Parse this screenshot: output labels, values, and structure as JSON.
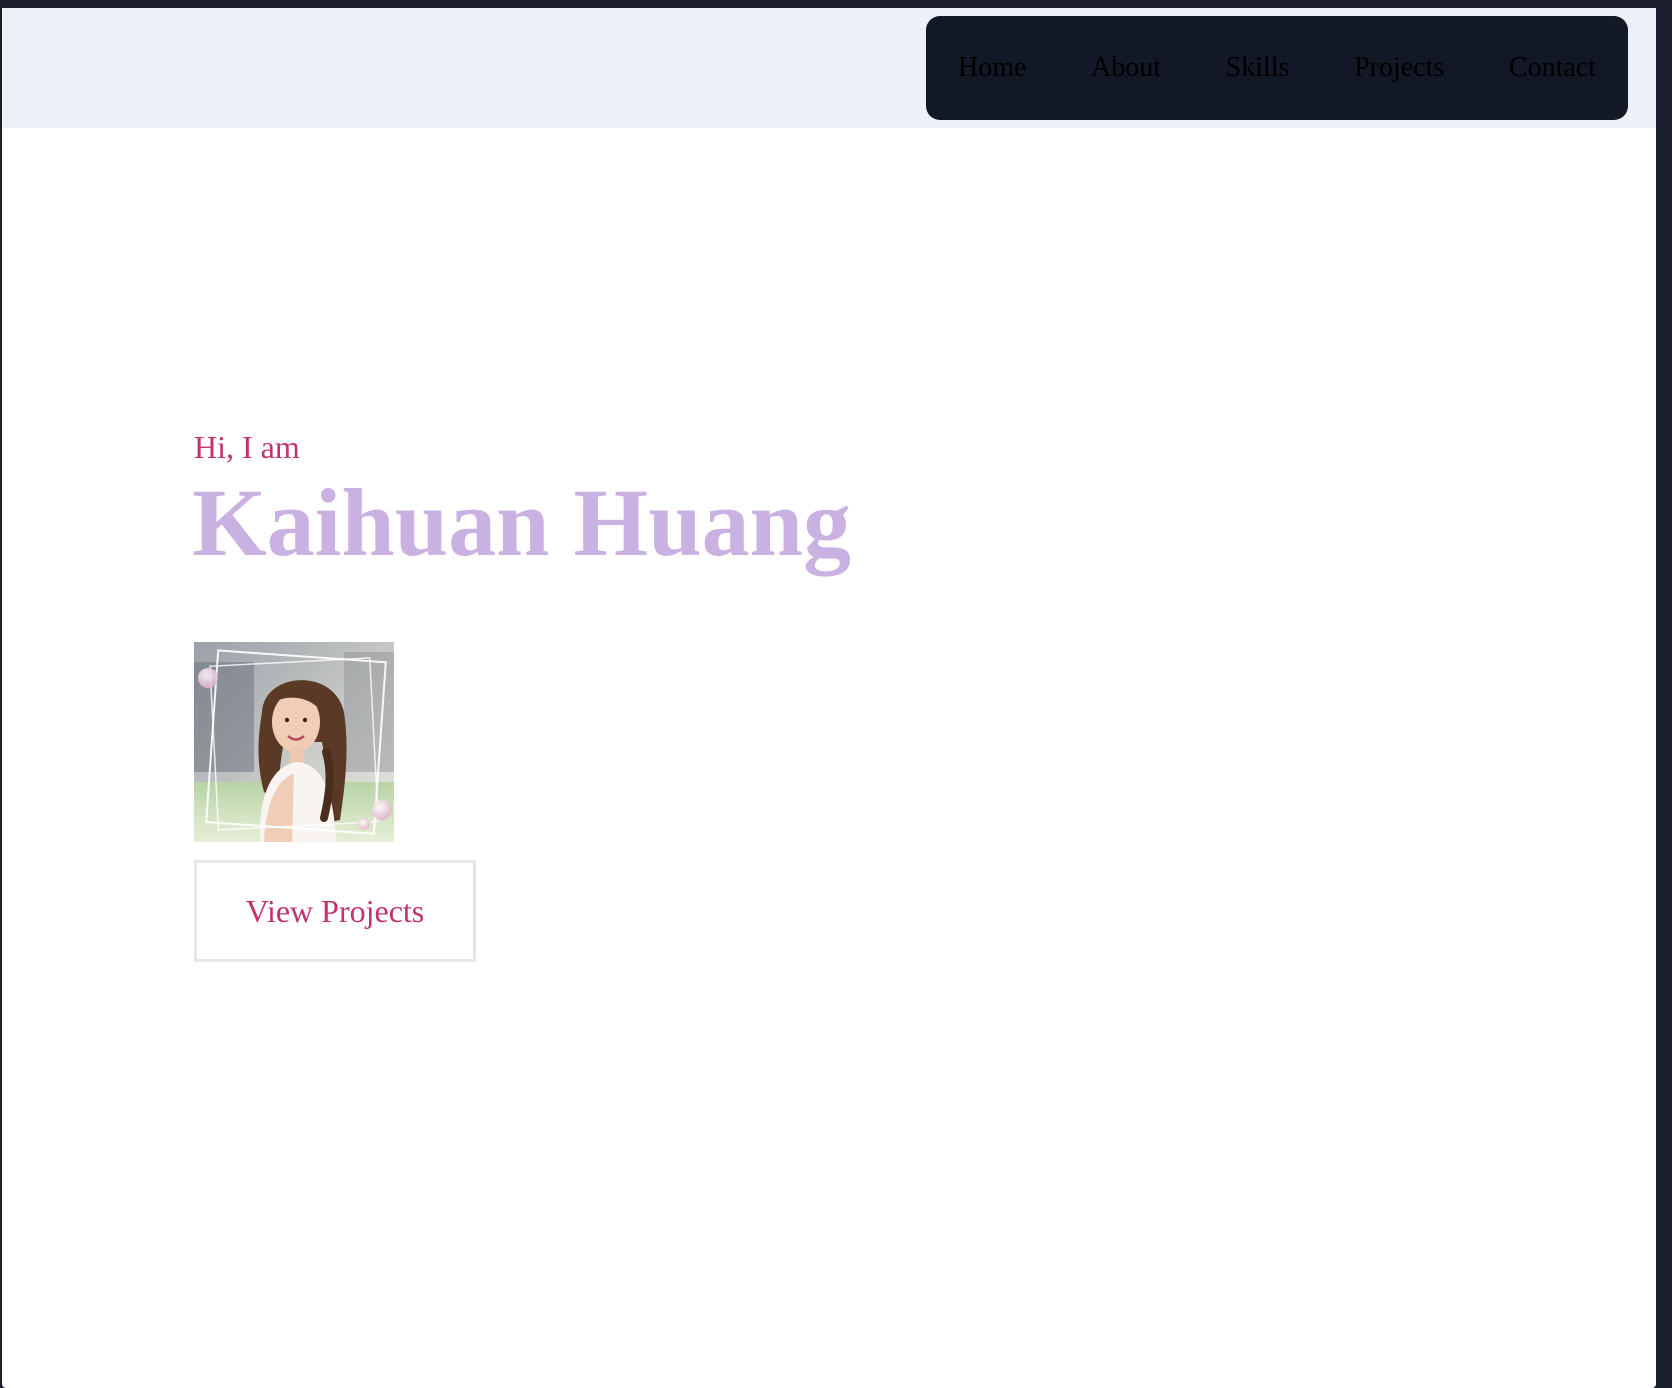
{
  "nav": {
    "items": [
      {
        "label": "Home"
      },
      {
        "label": "About"
      },
      {
        "label": "Skills"
      },
      {
        "label": "Projects"
      },
      {
        "label": "Contact"
      }
    ]
  },
  "hero": {
    "greeting": "Hi, I am",
    "name": "Kaihuan Huang",
    "cta_label": "View Projects",
    "photo_icon": "portrait-photo"
  },
  "colors": {
    "page_bg": "#1a1d2b",
    "header_bg": "#ecf0f8",
    "nav_bg": "#121826",
    "accent": "#c0336e",
    "name": "#c9b2e2"
  }
}
